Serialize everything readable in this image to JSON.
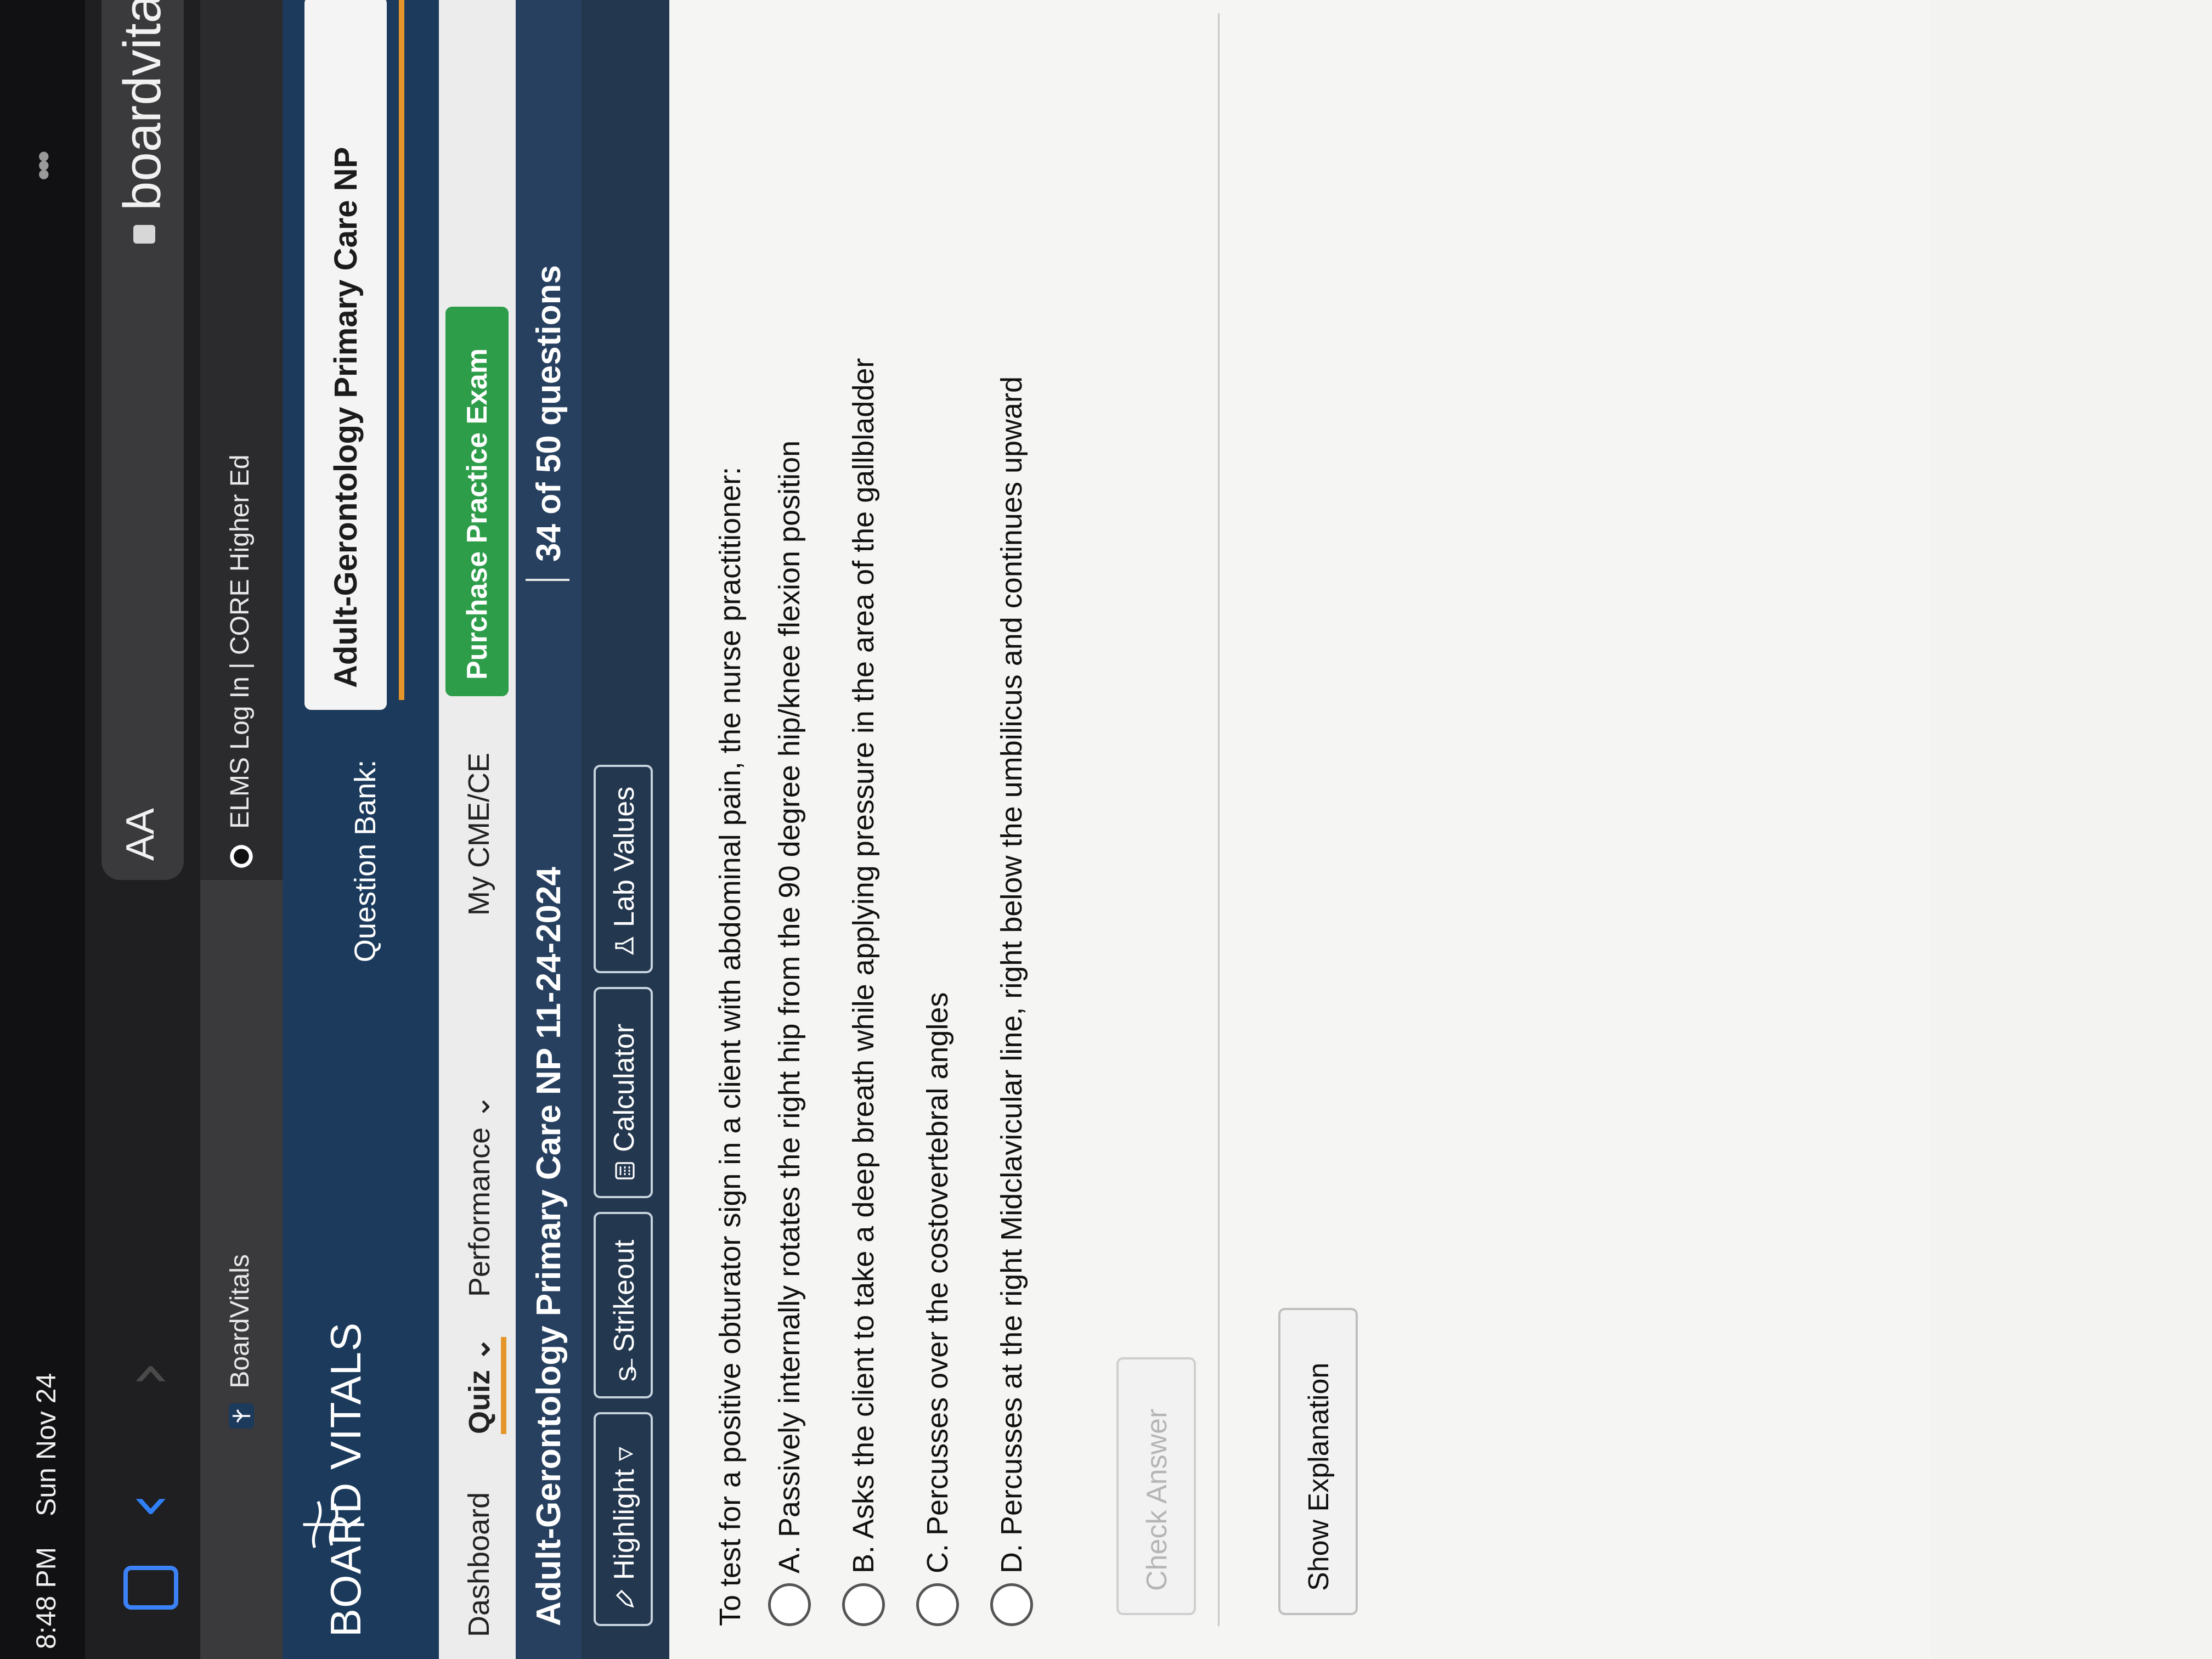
{
  "status_bar": {
    "time": "8:48 PM",
    "date": "Sun Nov 24"
  },
  "browser": {
    "aa_label": "AA",
    "url": "boardvitals.c",
    "icons": [
      "sidebar-icon",
      "back-chevron-icon",
      "forward-chevron-icon",
      "lock-icon",
      "more-dots-icon"
    ]
  },
  "tabs": [
    {
      "label": "BoardVitals"
    },
    {
      "label": "ELMS Log In | CORE Higher Ed"
    }
  ],
  "header": {
    "logo_text": "BOARD VITALS",
    "question_bank_label": "Question Bank:",
    "question_bank_value": "Adult-Gerontology Primary Care NP"
  },
  "nav": {
    "dashboard": "Dashboard",
    "quiz": "Quiz",
    "performance": "Performance",
    "cme": "My CME/CE",
    "purchase": "Purchase Practice Exam"
  },
  "quiz": {
    "title": "Adult-Gerontology Primary Care NP 11-24-2024",
    "count": "34 of 50 questions"
  },
  "tools": {
    "highlight": "Highlight",
    "strikeout": "Strikeout",
    "calculator": "Calculator",
    "lab_values": "Lab Values"
  },
  "question": {
    "stem": "To test for a positive obturator sign in a client with abdominal pain, the nurse practitioner:",
    "answers": [
      "A. Passively internally rotates the right hip from the 90 degree hip/knee flexion position",
      "B. Asks the client to take a deep breath while applying pressure in the area of the gallbladder",
      "C. Percusses over the costovertebral angles",
      "D. Percusses at the right Midclavicular line, right below the umbilicus and continues upward"
    ],
    "check_answer": "Check Answer",
    "show_explanation": "Show Explanation"
  },
  "colors": {
    "header_navy": "#1b3a5c",
    "accent_orange": "#e5962a",
    "purchase_green": "#2e9d4a"
  }
}
